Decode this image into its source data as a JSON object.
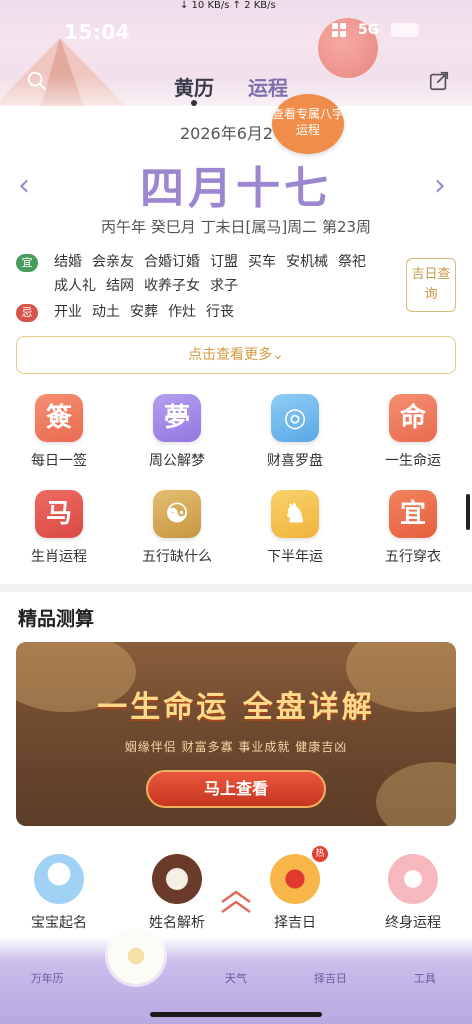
{
  "status": {
    "time": "15:04",
    "net_speed": "↓ 10 KB/s   ↑ 2 KB/s",
    "signal": "5G"
  },
  "header": {
    "tabs": [
      {
        "label": "黄历",
        "active": true
      },
      {
        "label": "运程",
        "active": false
      }
    ],
    "bubble_text": "查看专属八字运程",
    "search_icon": "search-icon",
    "share_icon": "share-icon"
  },
  "date": {
    "gregorian": "2026年6月2",
    "lunar": "四月十七",
    "ganzhi": "丙午年 癸巳月 丁未日[属马]周二  第23周"
  },
  "yiji": {
    "yi_tag": "宜",
    "ji_tag": "忌",
    "yi": [
      "结婚",
      "会亲友",
      "合婚订婚",
      "订盟",
      "买车",
      "安机械",
      "祭祀",
      "成人礼",
      "结网",
      "收养子女",
      "求子"
    ],
    "ji": [
      "开业",
      "动土",
      "安葬",
      "作灶",
      "行丧"
    ]
  },
  "jiri_button": "吉日查询",
  "more_button": "点击查看更多⌄",
  "tools": [
    {
      "glyph": "簽",
      "label": "每日一签",
      "cls": "i1"
    },
    {
      "glyph": "夢",
      "label": "周公解梦",
      "cls": "i2"
    },
    {
      "glyph": "◎",
      "label": "财喜罗盘",
      "cls": "i3"
    },
    {
      "glyph": "命",
      "label": "一生命运",
      "cls": "i4"
    },
    {
      "glyph": "马",
      "label": "生肖运程",
      "cls": "i5"
    },
    {
      "glyph": "☯",
      "label": "五行缺什么",
      "cls": "i6"
    },
    {
      "glyph": "♞",
      "label": "下半年运",
      "cls": "i7"
    },
    {
      "glyph": "宜",
      "label": "五行穿衣",
      "cls": "i8"
    }
  ],
  "section": {
    "title": "精品测算"
  },
  "banner": {
    "title": "一生命运 全盘详解",
    "subtitle": "姻缘伴侣 财富多寡 事业成就 健康吉凶",
    "button": "马上查看"
  },
  "shortcuts": [
    {
      "label": "宝宝起名",
      "cls": "s1"
    },
    {
      "label": "姓名解析",
      "cls": "s2"
    },
    {
      "label": "择吉日",
      "cls": "s3"
    },
    {
      "label": "终身运程",
      "cls": "s4"
    }
  ],
  "hot_badge": "热",
  "tabbar": [
    "万年历",
    "",
    "天气",
    "择吉日",
    "工具"
  ],
  "colors": {
    "accent_purple": "#9b86cf",
    "bubble_orange": "#f08d4a",
    "yi_green": "#4a9c5c",
    "ji_red": "#d8534a",
    "gold": "#d49a3e"
  }
}
